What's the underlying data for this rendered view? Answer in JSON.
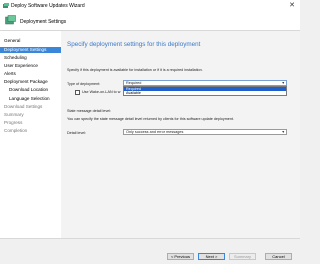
{
  "window": {
    "title": "Deploy Software Updates Wizard",
    "close_symbol": "✕"
  },
  "header": {
    "title": "Deployment Settings"
  },
  "sidebar": {
    "items": [
      {
        "label": "General",
        "state": "normal"
      },
      {
        "label": "Deployment Settings",
        "state": "active"
      },
      {
        "label": "Scheduling",
        "state": "normal"
      },
      {
        "label": "User Experience",
        "state": "normal"
      },
      {
        "label": "Alerts",
        "state": "normal"
      },
      {
        "label": "Deployment Package",
        "state": "normal"
      },
      {
        "label": "Download Location",
        "state": "sub"
      },
      {
        "label": "Language Selection",
        "state": "sub"
      },
      {
        "label": "Download Settings",
        "state": "disabled"
      },
      {
        "label": "Summary",
        "state": "disabled"
      },
      {
        "label": "Progress",
        "state": "disabled"
      },
      {
        "label": "Completion",
        "state": "disabled"
      }
    ]
  },
  "main": {
    "title": "Specify deployment settings for this deployment",
    "intro": "Specify if this deployment is available for installation or if it is a required installation.",
    "deployment_type": {
      "label": "Type of deployment:",
      "value": "Required",
      "options": [
        "Required",
        "Available"
      ],
      "highlighted": "Required"
    },
    "wake_on_lan": {
      "label": "Use Wake-on-LAN to w",
      "checked": false
    },
    "state_message": {
      "heading": "State message detail level:",
      "description": "You can specify the state message detail level returned by clients for this software update deployment.",
      "label": "Detail level:",
      "value": "Only success and error messages"
    }
  },
  "footer": {
    "previous_label": "< Previous",
    "next_label": "Next >",
    "summary_label": "Summary",
    "cancel_label": "Cancel"
  },
  "colors": {
    "accent": "#3a86d8",
    "title_blue": "#3b78c8",
    "highlight": "#1e5fcc"
  },
  "icons": {
    "title": "wizard-icon",
    "header": "deployment-settings-icon",
    "dropdown": "chevron-down-icon"
  }
}
